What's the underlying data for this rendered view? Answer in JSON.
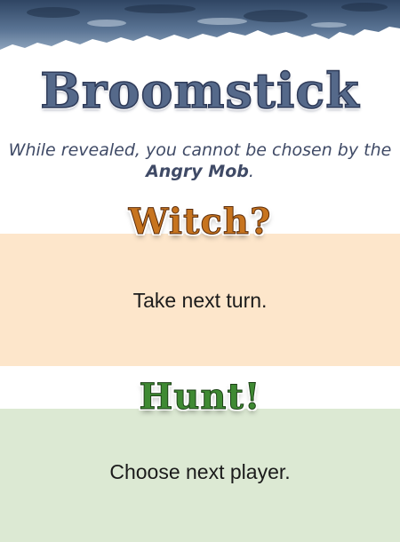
{
  "card": {
    "title": "Broomstick",
    "description_part1": "While revealed, you cannot be chosen by the ",
    "description_bold": "Angry Mob",
    "description_end": "."
  },
  "witch": {
    "badge": "Witch?",
    "text": "Take next turn.",
    "color": "#c7741f",
    "band_color": "#fde6cb"
  },
  "hunt": {
    "badge": "Hunt!",
    "text": "Choose next player.",
    "color": "#3f8a33",
    "band_color": "#dce9d3"
  },
  "colors": {
    "title": "#55698a",
    "header_art": "#3b4f6e"
  }
}
